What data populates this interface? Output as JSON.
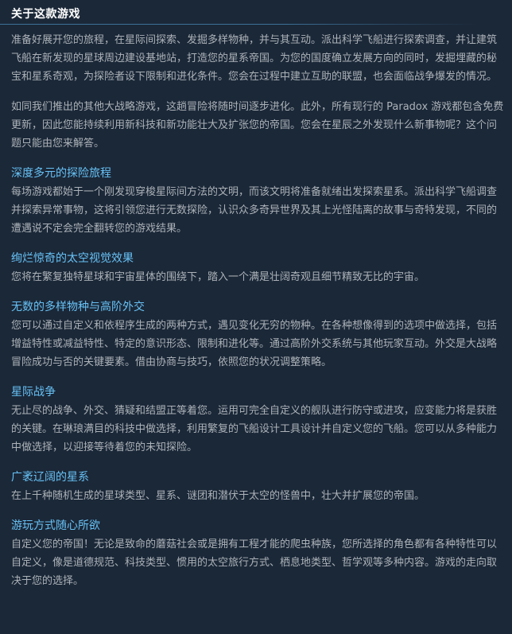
{
  "header": {
    "title": "关于这款游戏"
  },
  "intro": [
    "准备好展开您的旅程，在星际间探索、发掘多样物种，并与其互动。派出科学飞船进行探索调查，并让建筑飞船在新发现的星球周边建设基地站，打造您的星系帝国。为您的国度确立发展方向的同时，发掘埋藏的秘宝和星系奇观，为探险者设下限制和进化条件。您会在过程中建立互助的联盟，也会面临战争爆发的情况。",
    "如同我们推出的其他大战略游戏，这趟冒险将随时间逐步进化。此外，所有现行的 Paradox 游戏都包含免费更新，因此您能持续利用新科技和新功能壮大及扩张您的帝国。您会在星辰之外发现什么新事物呢？这个问题只能由您来解答。"
  ],
  "sections": [
    {
      "title": "深度多元的探险旅程",
      "body": "每场游戏都始于一个刚发现穿梭星际间方法的文明，而该文明将准备就绪出发探索星系。派出科学飞船调查并探索异常事物，这将引领您进行无数探险，认识众多奇异世界及其上光怪陆离的故事与奇特发现，不同的遭遇说不定会完全翻转您的游戏结果。"
    },
    {
      "title": "绚烂惊奇的太空视觉效果",
      "body": "您将在繁复独特星球和宇宙星体的围绕下，踏入一个满是壮阔奇观且细节精致无比的宇宙。"
    },
    {
      "title": "无数的多样物种与高阶外交",
      "body": "您可以通过自定义和依程序生成的两种方式，遇见变化无穷的物种。在各种想像得到的选项中做选择，包括增益特性或减益特性、特定的意识形态、限制和进化等。通过高阶外交系统与其他玩家互动。外交是大战略冒险成功与否的关键要素。借由协商与技巧，依照您的状况调整策略。"
    },
    {
      "title": "星际战争",
      "body": "无止尽的战争、外交、猜疑和结盟正等着您。运用可完全自定义的舰队进行防守或进攻，应变能力将是获胜的关键。在琳琅满目的科技中做选择，利用繁复的飞船设计工具设计并自定义您的飞船。您可以从多种能力中做选择，以迎接等待着您的未知探险。"
    },
    {
      "title": "广袤辽阔的星系",
      "body": "在上千种随机生成的星球类型、星系、谜团和潜伏于太空的怪兽中，壮大并扩展您的帝国。"
    },
    {
      "title": "游玩方式随心所欲",
      "body": "自定义您的帝国！无论是致命的蘑菇社会或是拥有工程才能的爬虫种族，您所选择的角色都有各种特性可以自定义，像是道德规范、科技类型、惯用的太空旅行方式、栖息地类型、哲学观等多种内容。游戏的走向取决于您的选择。"
    }
  ]
}
